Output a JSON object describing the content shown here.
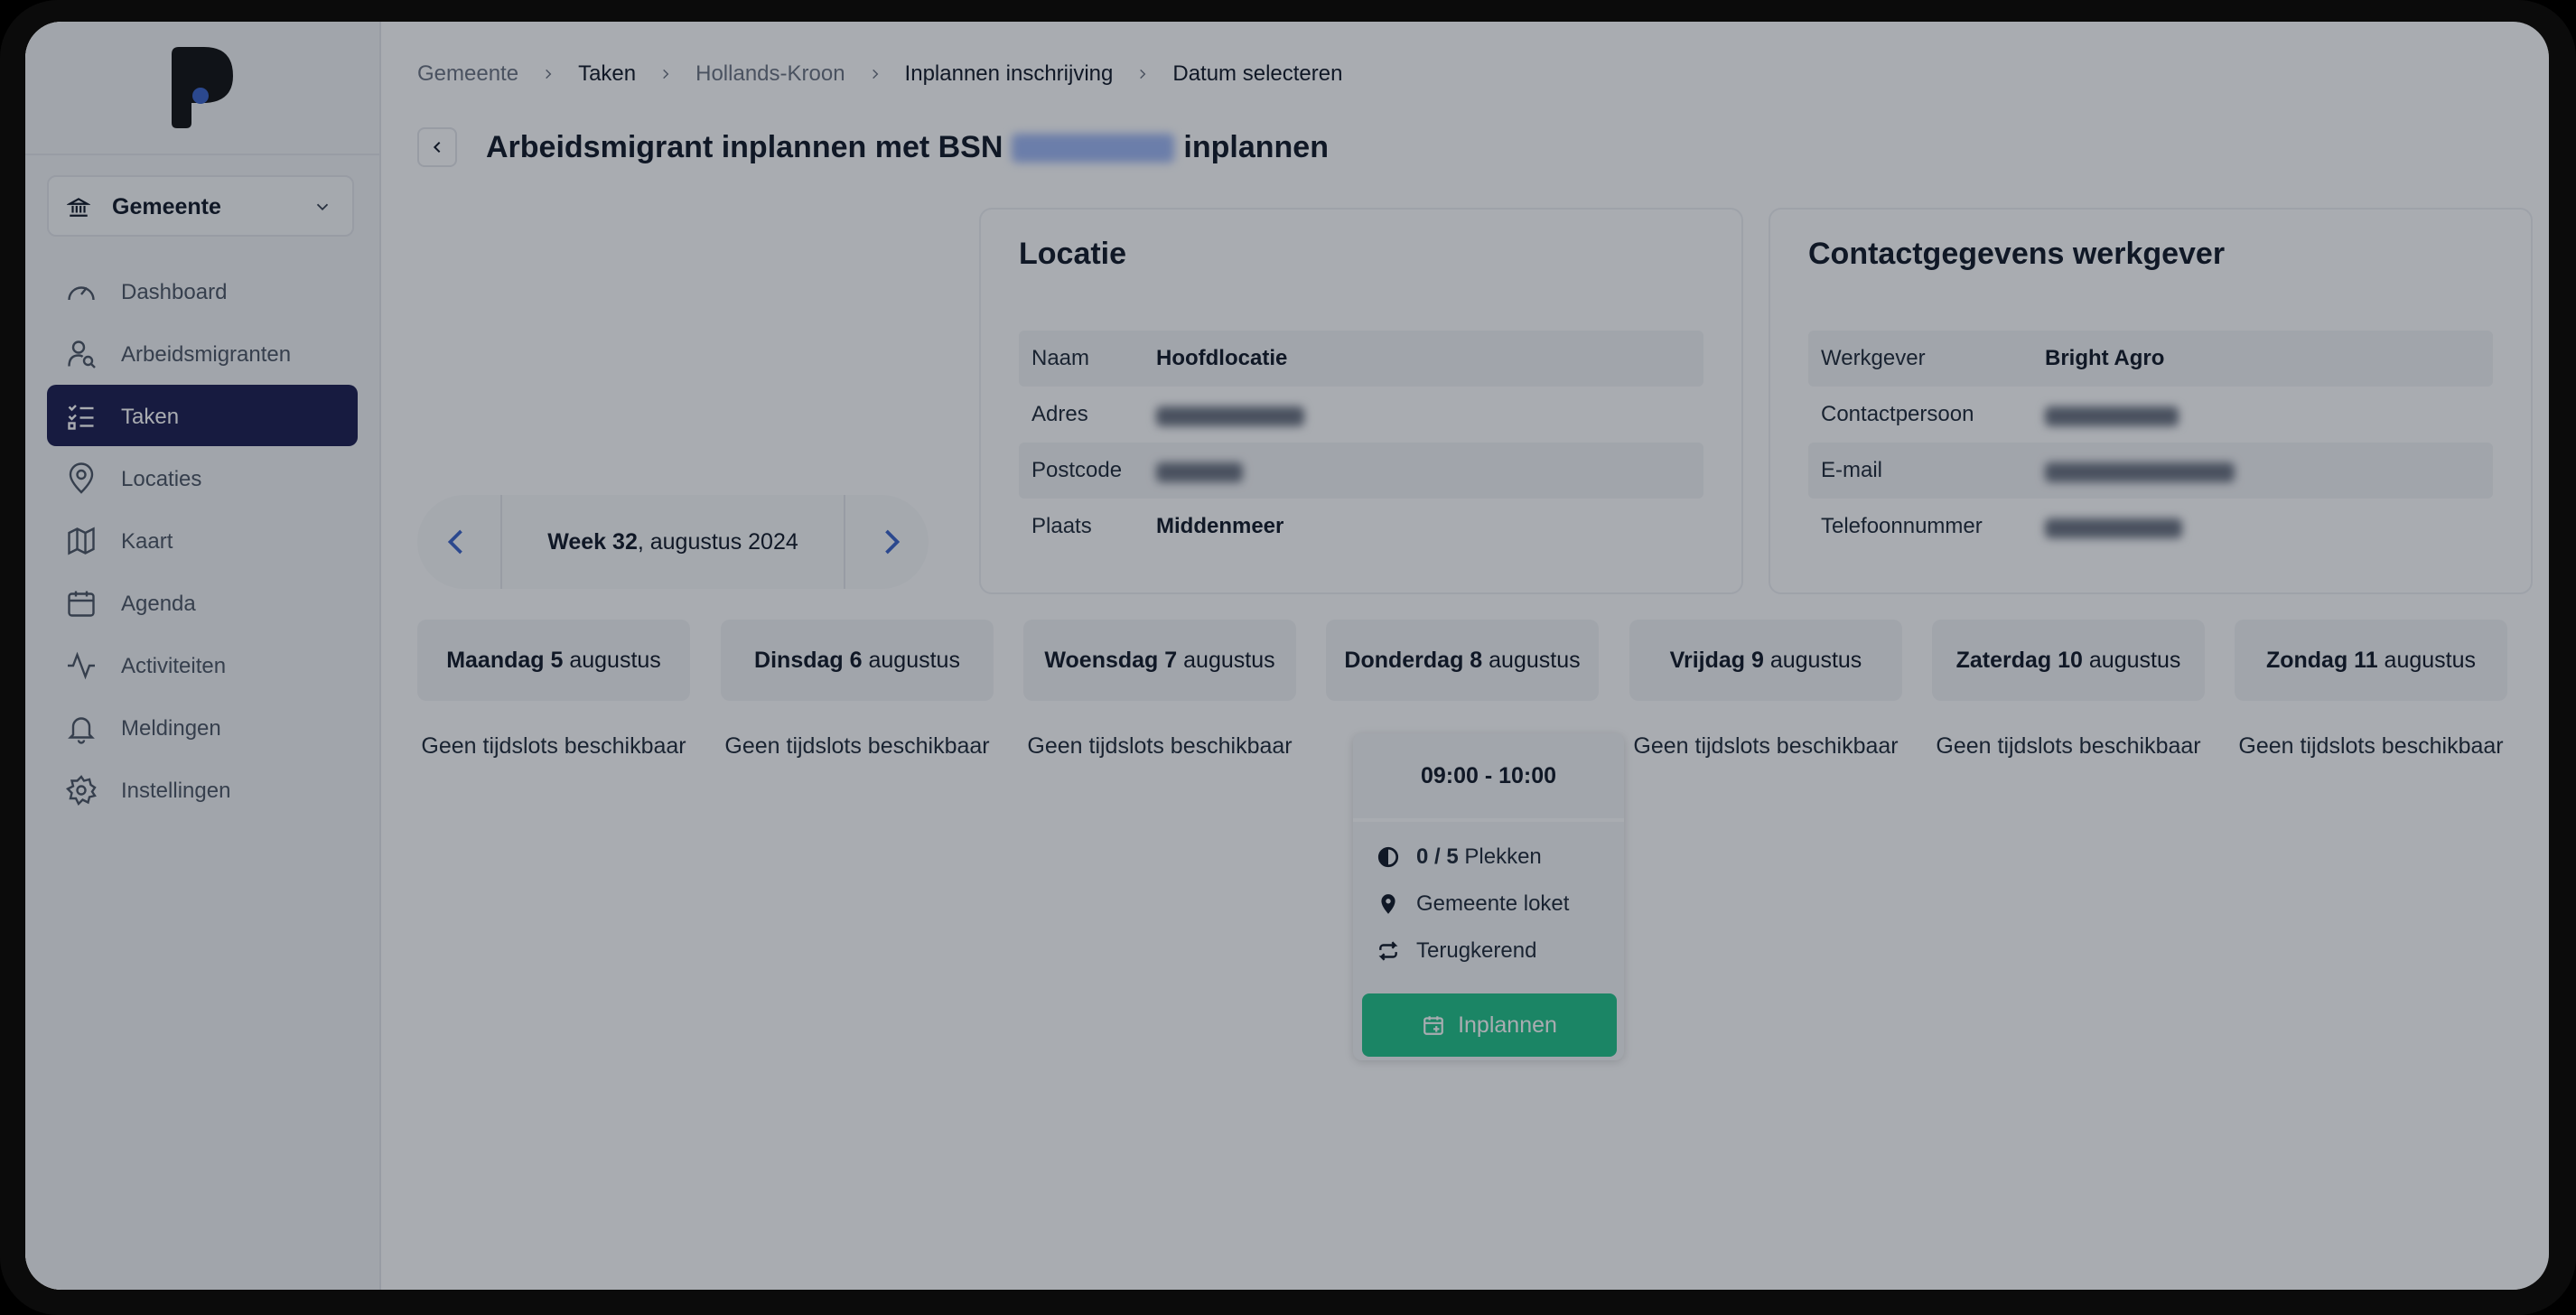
{
  "sidebar": {
    "tenant": "Gemeente",
    "items": [
      {
        "label": "Dashboard",
        "icon": "gauge-icon"
      },
      {
        "label": "Arbeidsmigranten",
        "icon": "user-search-icon"
      },
      {
        "label": "Taken",
        "icon": "checklist-icon",
        "active": true
      },
      {
        "label": "Locaties",
        "icon": "map-pin-icon"
      },
      {
        "label": "Kaart",
        "icon": "map-icon"
      },
      {
        "label": "Agenda",
        "icon": "calendar-icon"
      },
      {
        "label": "Activiteiten",
        "icon": "activity-icon"
      },
      {
        "label": "Meldingen",
        "icon": "bell-icon"
      },
      {
        "label": "Instellingen",
        "icon": "gear-icon"
      }
    ]
  },
  "breadcrumb": [
    "Gemeente",
    "Taken",
    "Hollands-Kroon",
    "Inplannen inschrijving",
    "Datum selecteren"
  ],
  "page": {
    "title_prefix": "Arbeidsmigrant inplannen met BSN",
    "title_suffix": "inplannen"
  },
  "location_card": {
    "title": "Locatie",
    "rows": [
      {
        "key": "Naam",
        "value": "Hoofdlocatie"
      },
      {
        "key": "Adres",
        "value": ""
      },
      {
        "key": "Postcode",
        "value": ""
      },
      {
        "key": "Plaats",
        "value": "Middenmeer"
      }
    ]
  },
  "contact_card": {
    "title": "Contactgegevens werkgever",
    "rows": [
      {
        "key": "Werkgever",
        "value": "Bright Agro"
      },
      {
        "key": "Contactpersoon",
        "value": ""
      },
      {
        "key": "E-mail",
        "value": ""
      },
      {
        "key": "Telefoonnummer",
        "value": ""
      }
    ]
  },
  "week_nav": {
    "week_label": "Week 32",
    "month_label": ", augustus 2024"
  },
  "days": [
    {
      "name": "Maandag 5",
      "month": " augustus",
      "empty": "Geen tijdslots beschikbaar"
    },
    {
      "name": "Dinsdag 6",
      "month": " augustus",
      "empty": "Geen tijdslots beschikbaar"
    },
    {
      "name": "Woensdag 7",
      "month": " augustus",
      "empty": "Geen tijdslots beschikbaar"
    },
    {
      "name": "Donderdag 8",
      "month": " augustus",
      "empty": ""
    },
    {
      "name": "Vrijdag 9",
      "month": " augustus",
      "empty": "Geen tijdslots beschikbaar"
    },
    {
      "name": "Zaterdag 10",
      "month": " augustus",
      "empty": "Geen tijdslots beschikbaar"
    },
    {
      "name": "Zondag 11",
      "month": " augustus",
      "empty": "Geen tijdslots beschikbaar"
    }
  ],
  "slot": {
    "time": "09:00 - 10:00",
    "capacity_value": "0 / 5",
    "capacity_label": "Plekken",
    "location": "Gemeente loket",
    "recurrence": "Terugkerend",
    "button": "Inplannen"
  },
  "colors": {
    "primary": "#1b1d4f",
    "accent": "#22c389",
    "link": "#3b63c9"
  }
}
